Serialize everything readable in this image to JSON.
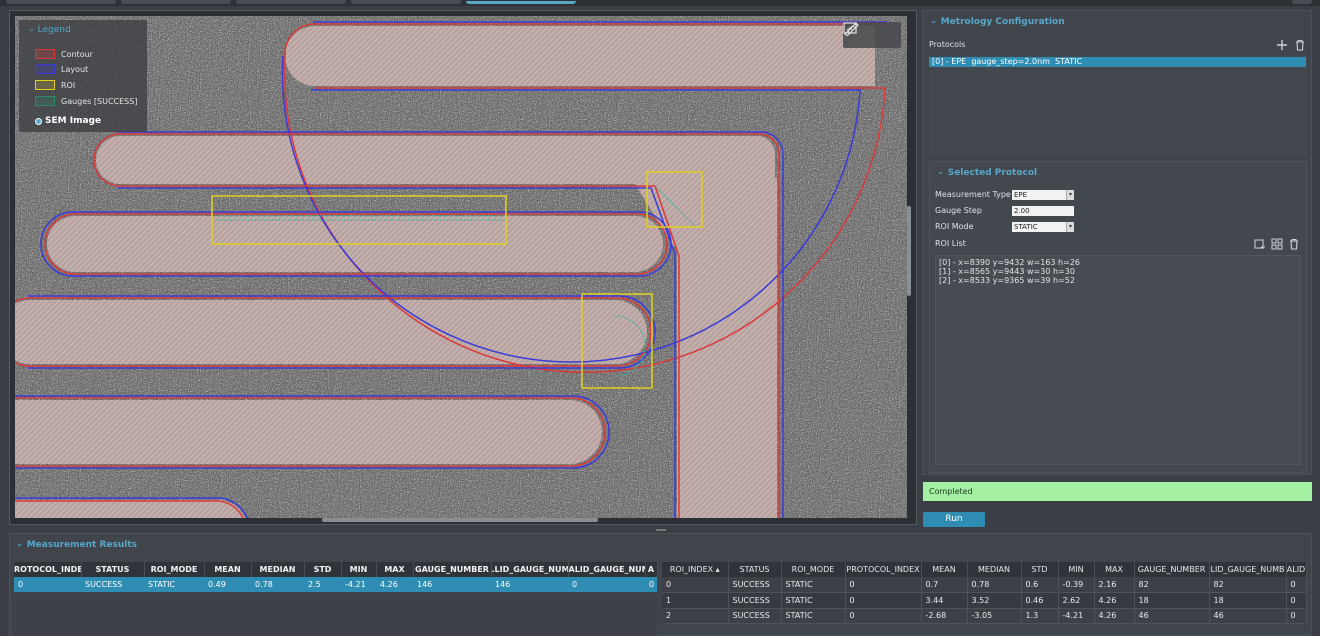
{
  "viewer": {
    "legend": {
      "title": "Legend",
      "items": [
        {
          "label": "Contour",
          "color": "#d93a3a"
        },
        {
          "label": "Layout",
          "color": "#3a3ad9"
        },
        {
          "label": "ROI",
          "color": "#e0d020"
        },
        {
          "label": "Gauges [SUCCESS]",
          "color": "#2f8a6a"
        }
      ],
      "sem_label": "SEM Image"
    },
    "tools": [
      "fit-view-icon",
      "ruler-icon"
    ]
  },
  "metrology": {
    "title": "Metrology Configuration",
    "protocols_label": "Protocols",
    "protocols": [
      "[0] - EPE  gauge_step=2.0nm  STATIC"
    ]
  },
  "selected_protocol": {
    "title": "Selected Protocol",
    "measurement_type_label": "Measurement Type",
    "measurement_type": "EPE",
    "gauge_step_label": "Gauge Step",
    "gauge_step": "2.00",
    "roi_mode_label": "ROI Mode",
    "roi_mode": "STATIC",
    "roi_list_label": "ROI List",
    "rois": [
      "[0] - x=8390 y=9432 w=163 h=26",
      "[1] - x=8565 y=9443 w=30 h=30",
      "[2] - x=8533 y=9365 w=39 h=52"
    ]
  },
  "status": "Completed",
  "run_label": "Run",
  "results": {
    "title": "Measurement Results",
    "summary_headers": [
      "ROTOCOL_INDE ▴",
      "STATUS",
      "ROI_MODE",
      "MEAN",
      "MEDIAN",
      "STD",
      "MIN",
      "MAX",
      "GAUGE_NUMBER",
      ".LID_GAUGE_NUMI",
      "ALID_GAUGE_NUM",
      "A"
    ],
    "summary_rows": [
      [
        "0",
        "SUCCESS",
        "STATIC",
        "0.49",
        "0.78",
        "2.5",
        "-4.21",
        "4.26",
        "146",
        "146",
        "0",
        "0"
      ]
    ],
    "roi_headers": [
      "ROI_INDEX ▴",
      "STATUS",
      "ROI_MODE",
      "PROTOCOL_INDEX",
      "MEAN",
      "MEDIAN",
      "STD",
      "MIN",
      "MAX",
      "GAUGE_NUMBER",
      "LID_GAUGE_NUMB",
      "ALID"
    ],
    "roi_rows": [
      [
        "0",
        "SUCCESS",
        "STATIC",
        "0",
        "0.7",
        "0.78",
        "0.6",
        "-0.39",
        "2.16",
        "82",
        "82",
        "0"
      ],
      [
        "1",
        "SUCCESS",
        "STATIC",
        "0",
        "3.44",
        "3.52",
        "0.46",
        "2.62",
        "4.26",
        "18",
        "18",
        "0"
      ],
      [
        "2",
        "SUCCESS",
        "STATIC",
        "0",
        "-2.68",
        "-3.05",
        "1.3",
        "-4.21",
        "4.26",
        "46",
        "46",
        "0"
      ]
    ]
  }
}
